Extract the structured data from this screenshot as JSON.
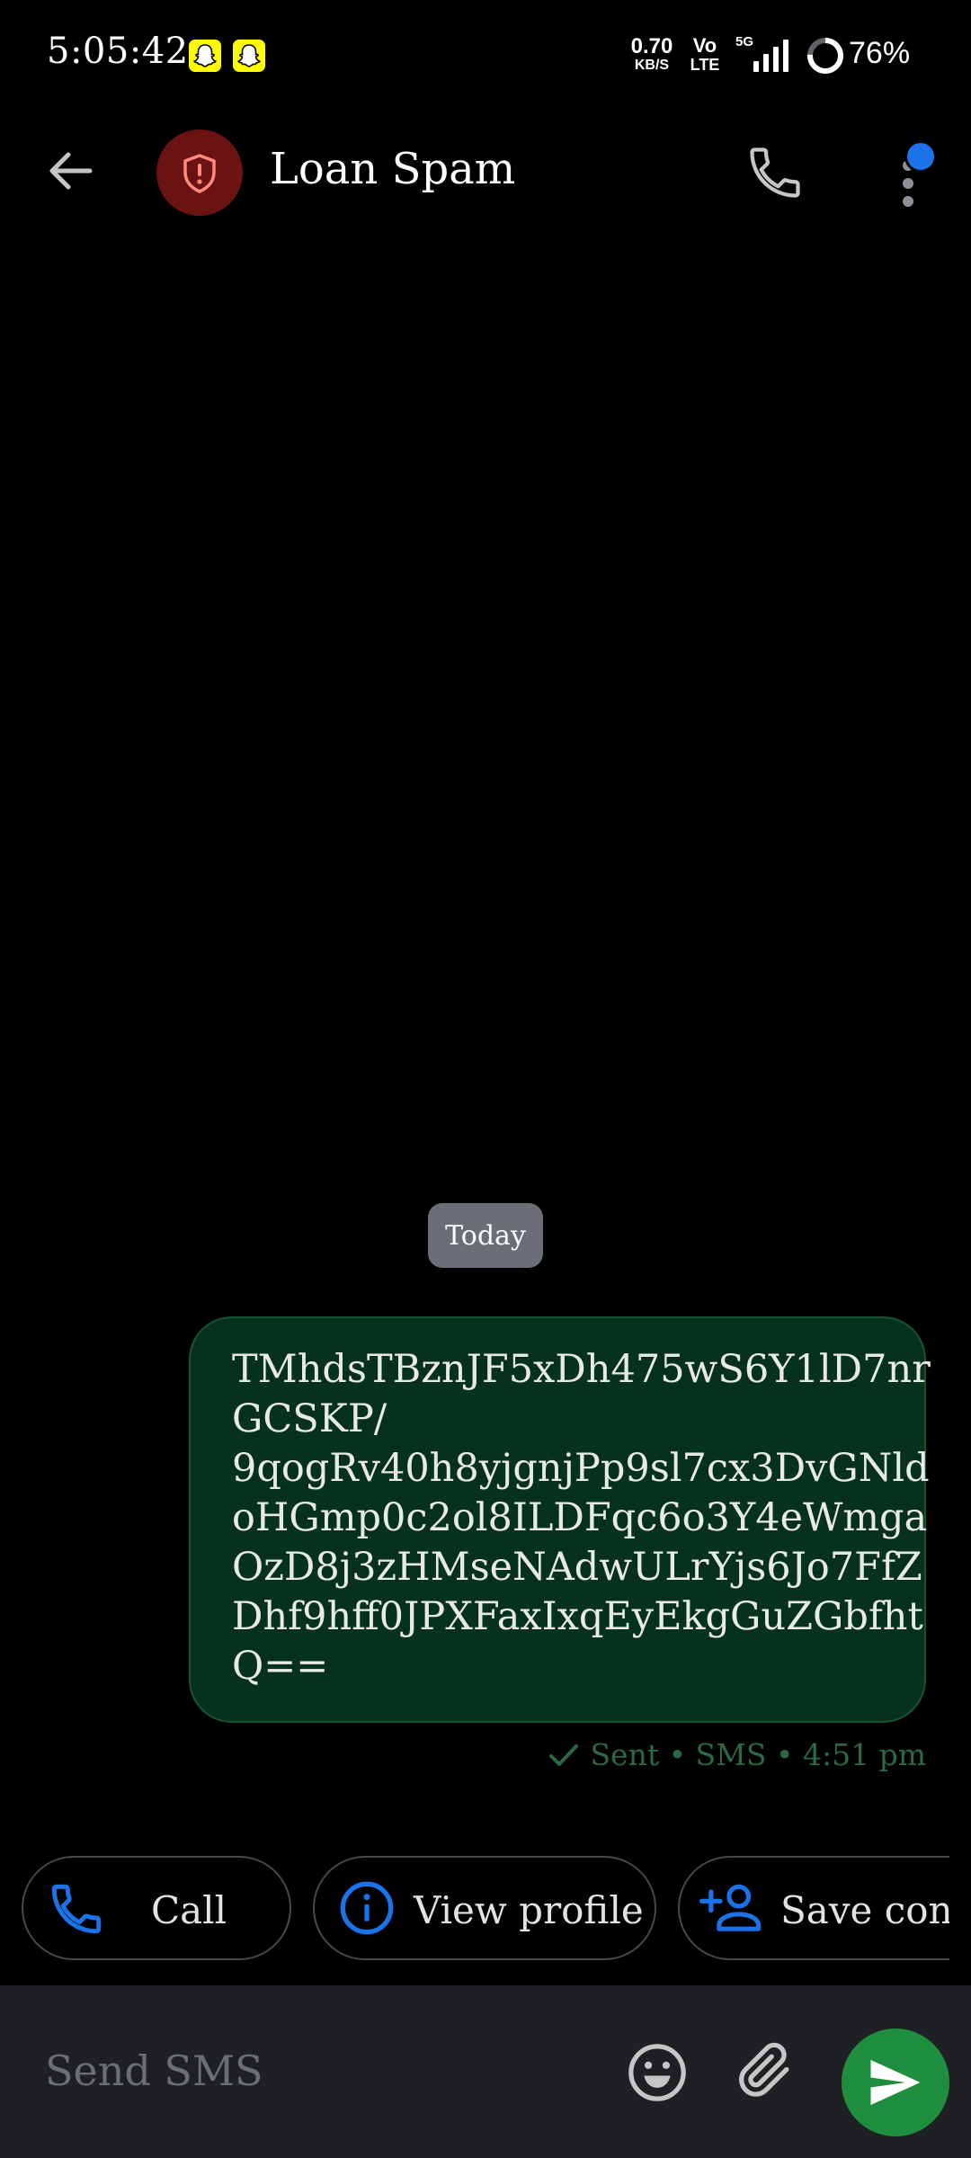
{
  "status_bar": {
    "time": "5:05:42",
    "net_speed_value": "0.70",
    "net_speed_unit": "KB/S",
    "volte_top": "Vo",
    "volte_bottom": "LTE",
    "network_type": "5G",
    "battery_percent": "76%",
    "notification_icons": [
      "snapchat-icon",
      "snapchat-icon"
    ]
  },
  "app_bar": {
    "contact_name": "Loan Spam",
    "avatar_icon": "shield-alert-icon",
    "actions": [
      "phone-icon",
      "more-vert-icon"
    ]
  },
  "conversation": {
    "date_label": "Today",
    "messages": [
      {
        "direction": "outgoing",
        "text": "TMhdsTBznJF5xDh475wS6Y1lD7nr\nGCSKP/\n9qogRv40h8yjgnjPp9sl7cx3DvGNld\noHGmp0c2ol8ILDFqc6o3Y4eWmga\nOzD8j3zHMseNAdwULrYjs6Jo7FfZ\nDhf9hff0JPXFaxIxqEyEkgGuZGbfht\nQ==",
        "status": "Sent • SMS • 4:51 pm"
      }
    ]
  },
  "suggestion_chips": [
    {
      "label": "Call",
      "icon": "phone-icon"
    },
    {
      "label": "View profile",
      "icon": "info-icon"
    },
    {
      "label": "Save conta",
      "icon": "person-add-icon"
    }
  ],
  "composer": {
    "placeholder": "Send SMS",
    "value": ""
  },
  "colors": {
    "background": "#000000",
    "bubble": "#06321d",
    "status_text": "#2b6a44",
    "accent_blue": "#1a73e8",
    "send_button": "#1e8e3e",
    "avatar": "#6b1313"
  }
}
